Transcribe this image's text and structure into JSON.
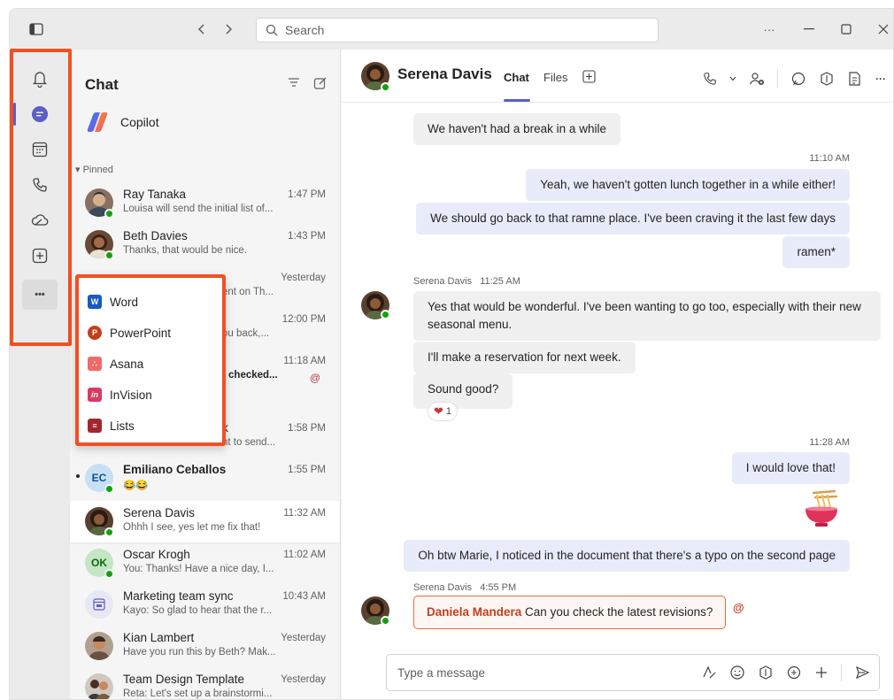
{
  "search": {
    "placeholder": "Search"
  },
  "window": {
    "more": "···"
  },
  "rail": {
    "more": "•••"
  },
  "chatlist": {
    "title": "Chat",
    "copilot_label": "Copilot",
    "pinned_label": "Pinned",
    "rows": [
      {
        "name": "Ray Tanaka",
        "preview": "Louisa will send the initial list of...",
        "time": "1:47 PM"
      },
      {
        "name": "Beth Davies",
        "preview": "Thanks, that would be nice.",
        "time": "1:43 PM"
      },
      {
        "name": "",
        "preview": "ent on Th...",
        "time": "Yesterday"
      },
      {
        "name": "",
        "preview": "ou back,...",
        "time": "12:00 PM"
      },
      {
        "name": "",
        "preview": "t checked...",
        "time": "11:18 AM",
        "at": "@"
      },
      {
        "name": "k",
        "preview": "nt to send...",
        "time": "1:58 PM"
      },
      {
        "name": "Emiliano Ceballos",
        "preview": "😂😂",
        "time": "1:55 PM",
        "initials": "EC"
      },
      {
        "name": "Serena Davis",
        "preview": "Ohhh I see, yes let me fix that!",
        "time": "11:32 AM"
      },
      {
        "name": "Oscar Krogh",
        "preview": "You: Thanks! Have a nice day, I...",
        "time": "11:02 AM",
        "initials": "OK"
      },
      {
        "name": "Marketing team sync",
        "preview": "Kayo: So glad to hear that the r...",
        "time": "10:43 AM"
      },
      {
        "name": "Kian Lambert",
        "preview": "Have you run this by Beth? Mak...",
        "time": "Yesterday"
      },
      {
        "name": "Team Design Template",
        "preview": "Reta: Let's set up a brainstormi...",
        "time": "Yesterday"
      }
    ]
  },
  "popup": {
    "items": [
      {
        "label": "Word",
        "icon": "word-icon",
        "color": "#185abd",
        "glyph": "W"
      },
      {
        "label": "PowerPoint",
        "icon": "powerpoint-icon",
        "color": "#c43e1c",
        "glyph": "P"
      },
      {
        "label": "Asana",
        "icon": "asana-icon",
        "color": "#f06a6a",
        "glyph": "∴"
      },
      {
        "label": "InVision",
        "icon": "invision-icon",
        "color": "#dc395f",
        "glyph": "in"
      },
      {
        "label": "Lists",
        "icon": "lists-icon",
        "color": "#a4262c",
        "glyph": "≡"
      }
    ]
  },
  "conversation": {
    "name": "Serena Davis",
    "tabs": [
      "Chat",
      "Files"
    ],
    "messages": {
      "m1": "We haven't had a break in a while",
      "t1": "11:10 AM",
      "m2": "Yeah, we haven't gotten lunch together in a while either!",
      "m3": "We should go back to that ramne place. I've been craving it the last few days",
      "m4": "ramen*",
      "meta1": "Serena Davis   11:25 AM",
      "m5a": "Yes that would be wonderful. I've been wanting to go too, especially with their new",
      "m5b": "seasonal menu.",
      "m6": "I'll make a reservation for next week.",
      "m7": "Sound good?",
      "reaction_count": "1",
      "t2": "11:28 AM",
      "m8": "I would love that!",
      "emoji": "🍜",
      "m9": "Oh btw Marie, I noticed in the document that there's a typo on the second page",
      "meta2": "Serena Davis   4:55 PM",
      "mention_name": "Daniela Mandera",
      "mention_text": " Can you check the latest revisions?",
      "mention_at": "@"
    },
    "composer_placeholder": "Type a message"
  },
  "colors": {
    "accent": "#5b5fc7",
    "annotation": "#f25022",
    "online": "#13a10e"
  }
}
